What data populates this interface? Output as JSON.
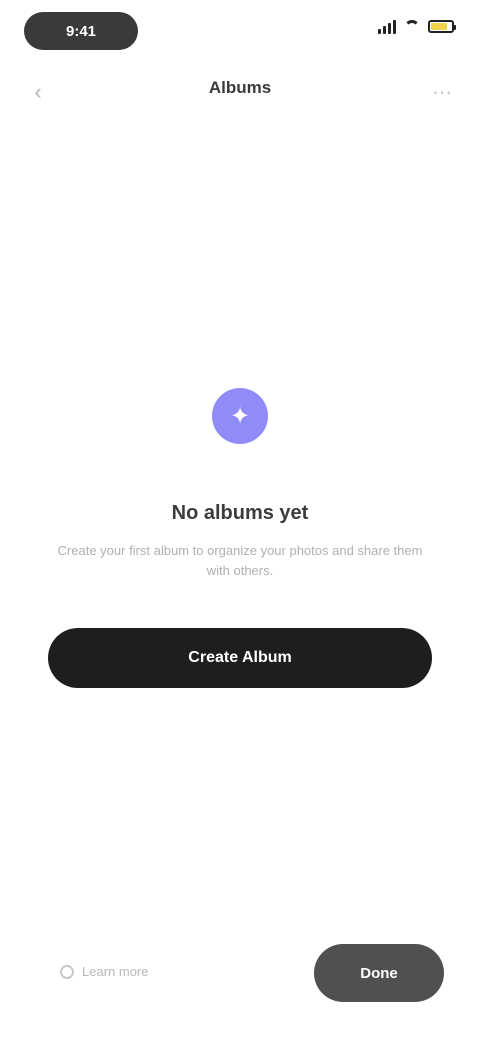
{
  "status_bar": {
    "time": "9:41",
    "battery_color": "#f1d44a"
  },
  "nav": {
    "title": "Albums",
    "back_icon": "chevron-left-icon",
    "action_icon": "more-icon"
  },
  "empty_state": {
    "icon": "photo-icon",
    "icon_color": "#8f8cf7",
    "title": "No albums yet",
    "body": "Create your first album to organize your photos and share them with others."
  },
  "primary_button": {
    "label": "Create Album"
  },
  "bottom": {
    "link_label": "Learn more",
    "secondary_button_label": "Done"
  }
}
